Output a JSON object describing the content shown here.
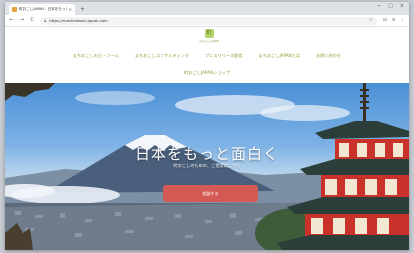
{
  "browser": {
    "tab_title": "町おこしJAPAN - 日本をもっと面白く",
    "tab_close": "×",
    "new_tab": "+",
    "back": "←",
    "forward": "→",
    "reload": "C",
    "url": "https://machiokoshi-japan.com",
    "star": "☆",
    "toolbar_icons": [
      "⊡",
      "≡",
      "⋮"
    ],
    "window_controls": [
      "−",
      "□",
      "×"
    ]
  },
  "site": {
    "logo_text": "まちおこしJAPAN",
    "nav_row1": [
      "まちおこしの日・ツール",
      "まちおこしコンサルティング",
      "プレスリリース配信",
      "まちおこしJAPANとは",
      "お問い合わせ"
    ],
    "nav_row2": [
      "町おこしJAPANショップ"
    ]
  },
  "hero": {
    "title": "日本をもっと面白く",
    "subtitle": "町おこしのための、ご提案はこちら",
    "cta_label": "相談する"
  },
  "colors": {
    "nav_link": "#8aa23a",
    "cta": "#d45a55",
    "pagoda_red": "#c8322b"
  }
}
